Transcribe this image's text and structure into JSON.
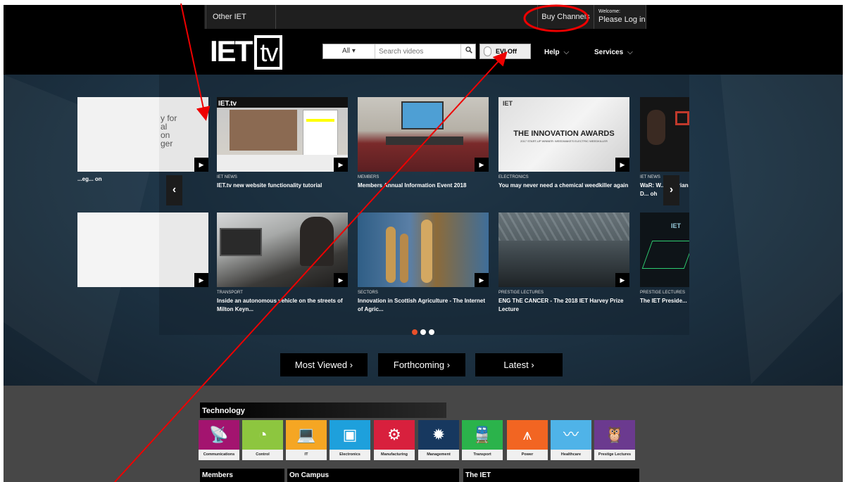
{
  "topbar": {
    "other_sites": "Other IET websites ▾",
    "buy_channels": "Buy Channels",
    "welcome": "Welcome:",
    "login": "Please Log in ▶"
  },
  "header": {
    "logo_main": "IET",
    "logo_tv": "tv",
    "search_scope": "All ▾",
    "search_placeholder": "Search videos",
    "search_icon": "magnifier",
    "evi_label": "EVI Off",
    "nav": [
      {
        "label": "Help"
      },
      {
        "label": "Services"
      }
    ]
  },
  "carousel": {
    "row1": [
      {
        "category": "",
        "title": "...eg... on",
        "partial": true
      },
      {
        "category": "IET NEWS",
        "title": "IET.tv new website functionality tutorial"
      },
      {
        "category": "MEMBERS",
        "title": "Members Annual Information Event 2018"
      },
      {
        "category": "ELECTRONICS",
        "title": "You may never need a chemical weedkiller again"
      },
      {
        "category": "IET NEWS",
        "title": "WaR: W... ar Brian D... oh"
      }
    ],
    "row2": [
      {
        "category": "TRANSPORT",
        "title": "Inside an autonomous vehicle on the streets of Milton Keyn..."
      },
      {
        "category": "SECTORS",
        "title": "Innovation in Scottish Agriculture - The Internet of Agric..."
      },
      {
        "category": "PRESTIGE LECTURES",
        "title": "ENG ThE CANCER - The 2018 IET Harvey Prize Lecture"
      },
      {
        "category": "PRESTIGE LECTURES",
        "title": "The IET Preside..."
      }
    ],
    "partial_text_1": "y for\nal\non\nger",
    "innovation_awards": "THE INNOVATION AWARDS",
    "innovation_sub": "2017 START-UP WINNER: WEEDWAKE'S ELECTRIC WEEDKILLER",
    "prev_arrow": "‹",
    "next_arrow": "›"
  },
  "hero_buttons": [
    {
      "label": "Most Viewed ›"
    },
    {
      "label": "Forthcoming ›"
    },
    {
      "label": "Latest ›"
    }
  ],
  "technology": {
    "title": "Technology",
    "items": [
      {
        "label": "Communications",
        "color": "#a3146f",
        "icon": "satellite-icon"
      },
      {
        "label": "Control",
        "color": "#8dc63f",
        "icon": "control-icon"
      },
      {
        "label": "IT",
        "color": "#f5a623",
        "icon": "laptop-icon"
      },
      {
        "label": "Electronics",
        "color": "#1ea0dc",
        "icon": "chip-icon"
      },
      {
        "label": "Manufacturing",
        "color": "#d8203d",
        "icon": "robot-arm-icon"
      },
      {
        "label": "Management",
        "color": "#17385f",
        "icon": "gear-icon"
      },
      {
        "label": "Transport",
        "color": "#2bb34b",
        "icon": "train-icon"
      },
      {
        "label": "Power",
        "color": "#f26522",
        "icon": "pylon-icon"
      },
      {
        "label": "Healthcare",
        "color": "#4fb3e8",
        "icon": "heartbeat-icon"
      },
      {
        "label": "Prestige Lectures",
        "color": "#6b3a8f",
        "icon": "owl-icon"
      }
    ]
  },
  "bottom_sections": [
    {
      "label": "Members"
    },
    {
      "label": "On Campus"
    },
    {
      "label": "The IET"
    }
  ]
}
